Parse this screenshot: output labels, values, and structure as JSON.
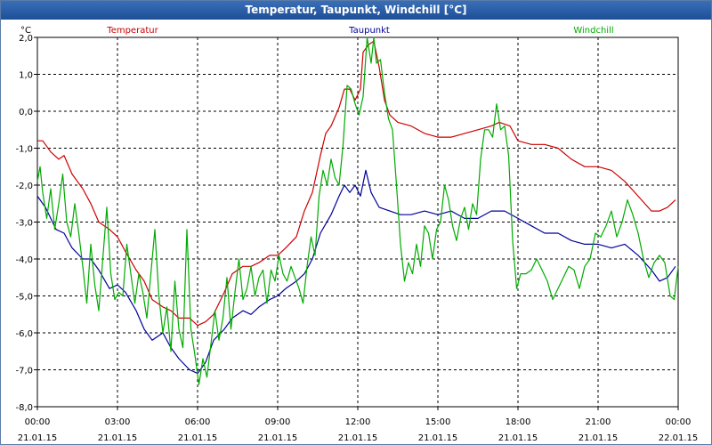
{
  "window": {
    "title": "Temperatur, Taupunkt, Windchill [°C]"
  },
  "chart_data": {
    "type": "line",
    "title": "Temperatur, Taupunkt, Windchill [°C]",
    "ylabel": "°C",
    "xlabel": "",
    "ylim": [
      -8,
      2
    ],
    "y_ticks": [
      "2,0",
      "1,0",
      "0,0",
      "-1,0",
      "-2,0",
      "-3,0",
      "-4,0",
      "-5,0",
      "-6,0",
      "-7,0",
      "-8,0"
    ],
    "x_range_hours": [
      0,
      24
    ],
    "x_ticks": [
      {
        "time": "00:00",
        "date": "21.01.15"
      },
      {
        "time": "03:00",
        "date": "21.01.15"
      },
      {
        "time": "06:00",
        "date": "21.01.15"
      },
      {
        "time": "09:00",
        "date": "21.01.15"
      },
      {
        "time": "12:00",
        "date": "21.01.15"
      },
      {
        "time": "15:00",
        "date": "21.01.15"
      },
      {
        "time": "18:00",
        "date": "21.01.15"
      },
      {
        "time": "21:00",
        "date": "21.01.15"
      },
      {
        "time": "00:00",
        "date": "22.01.15"
      }
    ],
    "grid": true,
    "legend": "top",
    "series": [
      {
        "name": "Temperatur",
        "color": "#cc0000",
        "points": [
          [
            0.0,
            -0.8
          ],
          [
            0.2,
            -0.8
          ],
          [
            0.5,
            -1.1
          ],
          [
            0.8,
            -1.3
          ],
          [
            1.0,
            -1.2
          ],
          [
            1.3,
            -1.7
          ],
          [
            1.7,
            -2.1
          ],
          [
            2.0,
            -2.5
          ],
          [
            2.3,
            -3.0
          ],
          [
            2.7,
            -3.2
          ],
          [
            3.0,
            -3.4
          ],
          [
            3.3,
            -3.8
          ],
          [
            3.7,
            -4.3
          ],
          [
            4.0,
            -4.6
          ],
          [
            4.3,
            -5.1
          ],
          [
            4.7,
            -5.3
          ],
          [
            5.0,
            -5.4
          ],
          [
            5.3,
            -5.6
          ],
          [
            5.7,
            -5.6
          ],
          [
            6.0,
            -5.8
          ],
          [
            6.3,
            -5.7
          ],
          [
            6.6,
            -5.5
          ],
          [
            7.0,
            -4.9
          ],
          [
            7.3,
            -4.4
          ],
          [
            7.7,
            -4.2
          ],
          [
            8.0,
            -4.2
          ],
          [
            8.3,
            -4.1
          ],
          [
            8.7,
            -3.9
          ],
          [
            9.0,
            -3.9
          ],
          [
            9.3,
            -3.7
          ],
          [
            9.7,
            -3.4
          ],
          [
            10.0,
            -2.7
          ],
          [
            10.3,
            -2.2
          ],
          [
            10.6,
            -1.2
          ],
          [
            10.8,
            -0.6
          ],
          [
            11.0,
            -0.4
          ],
          [
            11.3,
            0.1
          ],
          [
            11.5,
            0.6
          ],
          [
            11.7,
            0.6
          ],
          [
            11.9,
            0.3
          ],
          [
            12.1,
            0.6
          ],
          [
            12.2,
            1.6
          ],
          [
            12.4,
            1.8
          ],
          [
            12.6,
            1.9
          ],
          [
            12.8,
            1.2
          ],
          [
            13.0,
            0.3
          ],
          [
            13.2,
            -0.1
          ],
          [
            13.5,
            -0.3
          ],
          [
            14.0,
            -0.4
          ],
          [
            14.5,
            -0.6
          ],
          [
            15.0,
            -0.7
          ],
          [
            15.5,
            -0.7
          ],
          [
            16.0,
            -0.6
          ],
          [
            16.5,
            -0.5
          ],
          [
            17.0,
            -0.4
          ],
          [
            17.3,
            -0.3
          ],
          [
            17.7,
            -0.4
          ],
          [
            18.0,
            -0.8
          ],
          [
            18.5,
            -0.9
          ],
          [
            19.0,
            -0.9
          ],
          [
            19.5,
            -1.0
          ],
          [
            20.0,
            -1.3
          ],
          [
            20.5,
            -1.5
          ],
          [
            21.0,
            -1.5
          ],
          [
            21.5,
            -1.6
          ],
          [
            22.0,
            -1.9
          ],
          [
            22.5,
            -2.3
          ],
          [
            23.0,
            -2.7
          ],
          [
            23.3,
            -2.7
          ],
          [
            23.6,
            -2.6
          ],
          [
            23.9,
            -2.4
          ]
        ]
      },
      {
        "name": "Taupunkt",
        "color": "#000099",
        "points": [
          [
            0.0,
            -2.3
          ],
          [
            0.3,
            -2.6
          ],
          [
            0.7,
            -3.2
          ],
          [
            1.0,
            -3.3
          ],
          [
            1.3,
            -3.7
          ],
          [
            1.7,
            -4.0
          ],
          [
            2.0,
            -4.0
          ],
          [
            2.3,
            -4.3
          ],
          [
            2.7,
            -4.8
          ],
          [
            3.0,
            -4.7
          ],
          [
            3.3,
            -4.9
          ],
          [
            3.7,
            -5.4
          ],
          [
            4.0,
            -5.9
          ],
          [
            4.3,
            -6.2
          ],
          [
            4.7,
            -6.0
          ],
          [
            5.0,
            -6.4
          ],
          [
            5.3,
            -6.7
          ],
          [
            5.7,
            -7.0
          ],
          [
            6.0,
            -7.1
          ],
          [
            6.3,
            -6.8
          ],
          [
            6.6,
            -6.2
          ],
          [
            7.0,
            -5.9
          ],
          [
            7.3,
            -5.6
          ],
          [
            7.7,
            -5.4
          ],
          [
            8.0,
            -5.5
          ],
          [
            8.3,
            -5.3
          ],
          [
            8.7,
            -5.1
          ],
          [
            9.0,
            -5.0
          ],
          [
            9.3,
            -4.8
          ],
          [
            9.7,
            -4.6
          ],
          [
            10.0,
            -4.4
          ],
          [
            10.3,
            -4.0
          ],
          [
            10.6,
            -3.3
          ],
          [
            11.0,
            -2.8
          ],
          [
            11.3,
            -2.3
          ],
          [
            11.5,
            -2.0
          ],
          [
            11.7,
            -2.2
          ],
          [
            11.9,
            -2.0
          ],
          [
            12.1,
            -2.3
          ],
          [
            12.3,
            -1.6
          ],
          [
            12.5,
            -2.2
          ],
          [
            12.8,
            -2.6
          ],
          [
            13.2,
            -2.7
          ],
          [
            13.6,
            -2.8
          ],
          [
            14.0,
            -2.8
          ],
          [
            14.5,
            -2.7
          ],
          [
            15.0,
            -2.8
          ],
          [
            15.5,
            -2.7
          ],
          [
            16.0,
            -2.9
          ],
          [
            16.5,
            -2.9
          ],
          [
            17.0,
            -2.7
          ],
          [
            17.5,
            -2.7
          ],
          [
            18.0,
            -2.9
          ],
          [
            18.5,
            -3.1
          ],
          [
            19.0,
            -3.3
          ],
          [
            19.5,
            -3.3
          ],
          [
            20.0,
            -3.5
          ],
          [
            20.5,
            -3.6
          ],
          [
            21.0,
            -3.6
          ],
          [
            21.5,
            -3.7
          ],
          [
            22.0,
            -3.6
          ],
          [
            22.5,
            -3.9
          ],
          [
            23.0,
            -4.3
          ],
          [
            23.3,
            -4.6
          ],
          [
            23.6,
            -4.5
          ],
          [
            23.9,
            -4.2
          ]
        ]
      },
      {
        "name": "Windchill",
        "color": "#00aa00",
        "points": [
          [
            0.0,
            -1.9
          ],
          [
            0.1,
            -1.5
          ],
          [
            0.2,
            -2.2
          ],
          [
            0.35,
            -2.9
          ],
          [
            0.5,
            -2.1
          ],
          [
            0.65,
            -3.2
          ],
          [
            0.8,
            -2.5
          ],
          [
            0.95,
            -1.7
          ],
          [
            1.1,
            -3.0
          ],
          [
            1.25,
            -3.4
          ],
          [
            1.4,
            -2.5
          ],
          [
            1.55,
            -3.3
          ],
          [
            1.7,
            -4.2
          ],
          [
            1.85,
            -5.2
          ],
          [
            2.0,
            -3.6
          ],
          [
            2.15,
            -4.7
          ],
          [
            2.3,
            -5.4
          ],
          [
            2.45,
            -4.0
          ],
          [
            2.6,
            -2.6
          ],
          [
            2.75,
            -4.4
          ],
          [
            2.9,
            -5.1
          ],
          [
            3.05,
            -4.9
          ],
          [
            3.2,
            -5.0
          ],
          [
            3.35,
            -3.6
          ],
          [
            3.5,
            -4.4
          ],
          [
            3.65,
            -5.2
          ],
          [
            3.8,
            -4.4
          ],
          [
            3.95,
            -4.9
          ],
          [
            4.1,
            -5.6
          ],
          [
            4.25,
            -4.4
          ],
          [
            4.4,
            -3.2
          ],
          [
            4.55,
            -5.0
          ],
          [
            4.7,
            -6.0
          ],
          [
            4.85,
            -5.3
          ],
          [
            5.0,
            -6.5
          ],
          [
            5.15,
            -4.6
          ],
          [
            5.3,
            -5.9
          ],
          [
            5.45,
            -6.4
          ],
          [
            5.6,
            -3.2
          ],
          [
            5.75,
            -5.9
          ],
          [
            5.9,
            -6.6
          ],
          [
            6.05,
            -7.4
          ],
          [
            6.2,
            -6.7
          ],
          [
            6.35,
            -7.2
          ],
          [
            6.5,
            -6.3
          ],
          [
            6.65,
            -5.4
          ],
          [
            6.8,
            -6.2
          ],
          [
            6.95,
            -5.6
          ],
          [
            7.1,
            -4.5
          ],
          [
            7.25,
            -5.9
          ],
          [
            7.4,
            -4.9
          ],
          [
            7.55,
            -4.0
          ],
          [
            7.7,
            -5.1
          ],
          [
            7.85,
            -4.8
          ],
          [
            8.0,
            -4.2
          ],
          [
            8.15,
            -5.0
          ],
          [
            8.3,
            -4.5
          ],
          [
            8.45,
            -4.3
          ],
          [
            8.6,
            -5.2
          ],
          [
            8.75,
            -4.3
          ],
          [
            8.9,
            -4.6
          ],
          [
            9.05,
            -3.9
          ],
          [
            9.2,
            -4.4
          ],
          [
            9.35,
            -4.6
          ],
          [
            9.5,
            -4.2
          ],
          [
            9.65,
            -4.5
          ],
          [
            9.8,
            -4.8
          ],
          [
            9.95,
            -5.2
          ],
          [
            10.1,
            -4.2
          ],
          [
            10.25,
            -3.4
          ],
          [
            10.4,
            -3.9
          ],
          [
            10.55,
            -2.3
          ],
          [
            10.7,
            -1.6
          ],
          [
            10.85,
            -2.0
          ],
          [
            11.0,
            -1.3
          ],
          [
            11.15,
            -1.8
          ],
          [
            11.3,
            -2.0
          ],
          [
            11.45,
            -0.9
          ],
          [
            11.6,
            0.7
          ],
          [
            11.75,
            0.6
          ],
          [
            11.9,
            0.2
          ],
          [
            12.05,
            -0.1
          ],
          [
            12.2,
            0.4
          ],
          [
            12.35,
            2.0
          ],
          [
            12.5,
            1.3
          ],
          [
            12.6,
            2.0
          ],
          [
            12.7,
            1.3
          ],
          [
            12.85,
            1.4
          ],
          [
            13.0,
            0.5
          ],
          [
            13.15,
            -0.2
          ],
          [
            13.3,
            -0.5
          ],
          [
            13.45,
            -2.0
          ],
          [
            13.6,
            -3.6
          ],
          [
            13.75,
            -4.6
          ],
          [
            13.9,
            -4.1
          ],
          [
            14.05,
            -4.4
          ],
          [
            14.2,
            -3.6
          ],
          [
            14.35,
            -4.2
          ],
          [
            14.5,
            -3.1
          ],
          [
            14.65,
            -3.3
          ],
          [
            14.8,
            -4.0
          ],
          [
            14.95,
            -3.2
          ],
          [
            15.1,
            -3.0
          ],
          [
            15.25,
            -2.0
          ],
          [
            15.4,
            -2.4
          ],
          [
            15.55,
            -3.1
          ],
          [
            15.7,
            -3.5
          ],
          [
            15.85,
            -2.9
          ],
          [
            16.0,
            -2.6
          ],
          [
            16.15,
            -3.2
          ],
          [
            16.3,
            -2.5
          ],
          [
            16.45,
            -2.8
          ],
          [
            16.6,
            -1.3
          ],
          [
            16.75,
            -0.5
          ],
          [
            16.9,
            -0.5
          ],
          [
            17.05,
            -0.7
          ],
          [
            17.2,
            0.2
          ],
          [
            17.35,
            -0.5
          ],
          [
            17.5,
            -0.4
          ],
          [
            17.65,
            -1.2
          ],
          [
            17.8,
            -3.5
          ],
          [
            17.95,
            -4.8
          ],
          [
            18.1,
            -4.4
          ],
          [
            18.3,
            -4.4
          ],
          [
            18.5,
            -4.3
          ],
          [
            18.7,
            -4.0
          ],
          [
            18.9,
            -4.3
          ],
          [
            19.1,
            -4.6
          ],
          [
            19.3,
            -5.1
          ],
          [
            19.5,
            -4.8
          ],
          [
            19.7,
            -4.5
          ],
          [
            19.9,
            -4.2
          ],
          [
            20.1,
            -4.3
          ],
          [
            20.3,
            -4.8
          ],
          [
            20.5,
            -4.2
          ],
          [
            20.7,
            -4.0
          ],
          [
            20.9,
            -3.3
          ],
          [
            21.1,
            -3.4
          ],
          [
            21.3,
            -3.1
          ],
          [
            21.5,
            -2.7
          ],
          [
            21.7,
            -3.4
          ],
          [
            21.9,
            -3.0
          ],
          [
            22.1,
            -2.4
          ],
          [
            22.3,
            -2.8
          ],
          [
            22.5,
            -3.3
          ],
          [
            22.7,
            -4.0
          ],
          [
            22.9,
            -4.5
          ],
          [
            23.1,
            -4.1
          ],
          [
            23.3,
            -3.9
          ],
          [
            23.5,
            -4.1
          ],
          [
            23.7,
            -5.0
          ],
          [
            23.85,
            -5.1
          ],
          [
            24.0,
            -4.2
          ]
        ]
      }
    ]
  }
}
